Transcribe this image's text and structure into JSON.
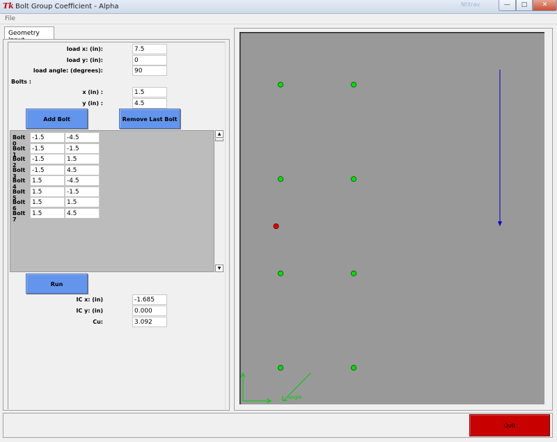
{
  "window": {
    "title": "Bolt Group Coefficient - Alpha",
    "logo": "Tk",
    "ghost_text": "Ntitrav",
    "minimize_glyph": "—",
    "maximize_glyph": "□",
    "close_glyph": "✕"
  },
  "menu": {
    "file": "File"
  },
  "tab": {
    "label": "Geometry Input"
  },
  "load": {
    "x_label": "load x: (in):",
    "x_value": "7.5",
    "y_label": "load y: (in):",
    "y_value": "0",
    "angle_label": "load angle: (degrees):",
    "angle_value": "90"
  },
  "bolts_section": {
    "label": "Bolts :",
    "x_label": "x (in) :",
    "x_value": "1.5",
    "y_label": "y (in) :",
    "y_value": "4.5"
  },
  "buttons": {
    "add_bolt": "Add Bolt",
    "remove_last_bolt": "Remove Last Bolt",
    "run": "Run",
    "quit": "Quit"
  },
  "bolt_list": [
    {
      "name": "Bolt 0",
      "x": "-1.5",
      "y": "-4.5"
    },
    {
      "name": "Bolt 1",
      "x": "-1.5",
      "y": "-1.5"
    },
    {
      "name": "Bolt 2",
      "x": "-1.5",
      "y": "1.5"
    },
    {
      "name": "Bolt 3",
      "x": "-1.5",
      "y": "4.5"
    },
    {
      "name": "Bolt 4",
      "x": "1.5",
      "y": "-4.5"
    },
    {
      "name": "Bolt 5",
      "x": "1.5",
      "y": "-1.5"
    },
    {
      "name": "Bolt 6",
      "x": "1.5",
      "y": "1.5"
    },
    {
      "name": "Bolt 7",
      "x": "1.5",
      "y": "4.5"
    }
  ],
  "scrollbar": {
    "up_glyph": "▲",
    "down_glyph": "▼"
  },
  "results": {
    "ic_x_label": "IC x: (in)",
    "ic_x_value": "-1.685",
    "ic_y_label": "IC y: (in)",
    "ic_y_value": "0.000",
    "cu_label": "Cu:",
    "cu_value": "3.092"
  },
  "canvas": {
    "background": "#999999",
    "bolt_color": "#00e000",
    "ic_color": "#e00000",
    "load_color": "#0000cc",
    "axis_color": "#00cc00",
    "bolts": [
      {
        "x": -1.5,
        "y": -4.5
      },
      {
        "x": -1.5,
        "y": -1.5
      },
      {
        "x": -1.5,
        "y": 1.5
      },
      {
        "x": -1.5,
        "y": 4.5
      },
      {
        "x": 1.5,
        "y": -4.5
      },
      {
        "x": 1.5,
        "y": -1.5
      },
      {
        "x": 1.5,
        "y": 1.5
      },
      {
        "x": 1.5,
        "y": 4.5
      }
    ],
    "ic": {
      "x": -1.685,
      "y": 0.0
    },
    "load": {
      "x": 7.5,
      "y": 0,
      "angle_deg": 90
    },
    "axis_label": "angle"
  }
}
